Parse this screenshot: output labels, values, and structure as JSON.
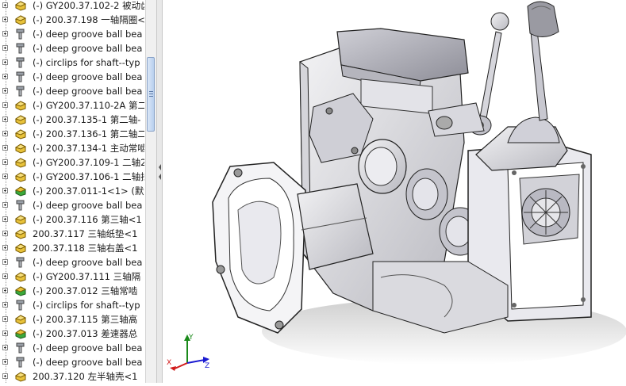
{
  "feature_tree": {
    "items": [
      {
        "label": "(-) GY200.37.102-2 被动齿",
        "icon": "part-icon"
      },
      {
        "label": "(-) 200.37.198 一轴隔圈<",
        "icon": "part-icon"
      },
      {
        "label": "(-) deep groove ball bea",
        "icon": "toolbox-part-icon"
      },
      {
        "label": "(-) deep groove ball bea",
        "icon": "toolbox-part-icon"
      },
      {
        "label": "(-) circlips for shaft--typ",
        "icon": "toolbox-part-icon"
      },
      {
        "label": "(-) deep groove ball bea",
        "icon": "toolbox-part-icon"
      },
      {
        "label": "(-) deep groove ball bea",
        "icon": "toolbox-part-icon"
      },
      {
        "label": "(-) GY200.37.110-2A 第二",
        "icon": "part-icon"
      },
      {
        "label": "(-) 200.37.135-1 第二轴-",
        "icon": "part-icon"
      },
      {
        "label": "(-) 200.37.136-1 第二轴二",
        "icon": "part-icon"
      },
      {
        "label": "(-) 200.37.134-1 主动常啮",
        "icon": "part-icon"
      },
      {
        "label": "(-) GY200.37.109-1 二轴2",
        "icon": "part-icon"
      },
      {
        "label": "(-) GY200.37.106-1 二轴挡",
        "icon": "part-icon"
      },
      {
        "label": "(-) 200.37.011-1<1> (默认",
        "icon": "subassembly-icon"
      },
      {
        "label": "(-) deep groove ball bea",
        "icon": "toolbox-part-icon"
      },
      {
        "label": "(-) 200.37.116    第三轴<1",
        "icon": "part-icon"
      },
      {
        "label": "200.37.117    三轴纸垫<1",
        "icon": "part-icon"
      },
      {
        "label": "200.37.118    三轴右盖<1",
        "icon": "part-icon"
      },
      {
        "label": "(-) deep groove ball bea",
        "icon": "toolbox-part-icon"
      },
      {
        "label": "(-) GY200.37.111 三轴隔",
        "icon": "part-icon"
      },
      {
        "label": "(-) 200.37.012    三轴常啮",
        "icon": "subassembly-icon"
      },
      {
        "label": "(-) circlips for shaft--typ",
        "icon": "toolbox-part-icon"
      },
      {
        "label": "(-) 200.37.115    第三轴高",
        "icon": "part-icon"
      },
      {
        "label": "(-) 200.37.013    差速器总",
        "icon": "subassembly-icon"
      },
      {
        "label": "(-) deep groove ball bea",
        "icon": "toolbox-part-icon"
      },
      {
        "label": "(-) deep groove ball bea",
        "icon": "toolbox-part-icon"
      },
      {
        "label": "200.37.120    左半轴壳<1",
        "icon": "part-icon"
      }
    ]
  },
  "triad": {
    "x_label": "X",
    "y_label": "Y",
    "z_label": "Z"
  },
  "colors": {
    "x_axis": "#d11a1a",
    "y_axis": "#1a8a1a",
    "z_axis": "#1a1ad1",
    "part_icon": "#e8c23a",
    "subassembly_icon": "#3aa83a"
  }
}
